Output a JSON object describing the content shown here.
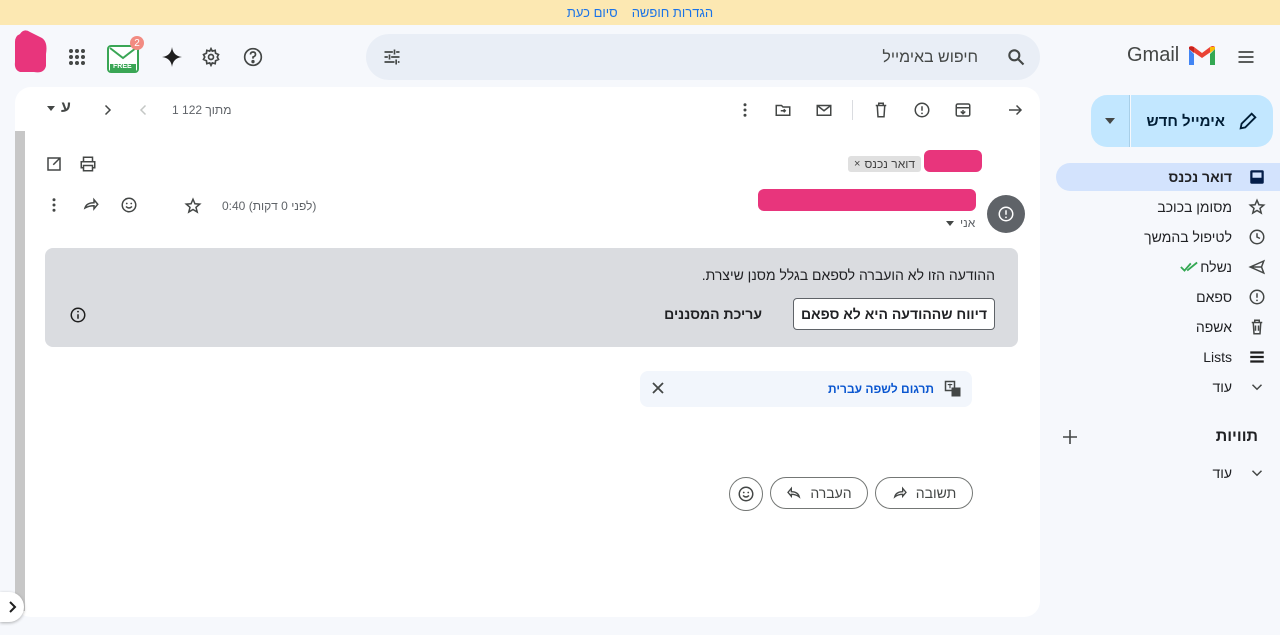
{
  "banner": {
    "text_a": "סיום כעת",
    "text_b": "הגדרות חופשה"
  },
  "header": {
    "search_placeholder": "חיפוש באימייל",
    "logo_text": "Gmail",
    "app_badge_count": "2",
    "app_badge_label": "FREE"
  },
  "sidebar": {
    "compose_label": "אימייל חדש",
    "items": [
      {
        "label": "דואר נכנס",
        "icon": "inbox-icon"
      },
      {
        "label": "מסומן בכוכב",
        "icon": "star-icon"
      },
      {
        "label": "לטיפול בהמשך",
        "icon": "clock-icon"
      },
      {
        "label": "נשלח",
        "icon": "send-icon"
      },
      {
        "label": "ספאם",
        "icon": "spam-icon"
      },
      {
        "label": "אשפה",
        "icon": "trash-icon"
      },
      {
        "label": "Lists",
        "icon": "lists-icon"
      },
      {
        "label": "עוד",
        "icon": "chevron-down-icon"
      }
    ],
    "labels_title": "תוויות",
    "labels_more": "עוד"
  },
  "toolbar": {
    "pagination": "1 מתוך 122",
    "lang_toggle": "ע"
  },
  "message": {
    "label_chip": "דואר נכנס",
    "time": "0:40 (לפני 0 דקות)",
    "to_me": "אני",
    "spam_notice": "ההודעה הזו לא הועברה לספאם בגלל מסנן שיצרת.",
    "report_not_spam": "דיווח שההודעה היא לא ספאם",
    "edit_filters": "עריכת המסננים",
    "translate": "תרגום לשפה עברית",
    "reply": "תשובה",
    "forward": "העברה"
  },
  "colors": {
    "accent": "#1a73e8",
    "compose_bg": "#c2e7ff",
    "active_nav": "#d3e3fd",
    "banner_bg": "#fce8b2",
    "redaction": "#e8357c"
  }
}
